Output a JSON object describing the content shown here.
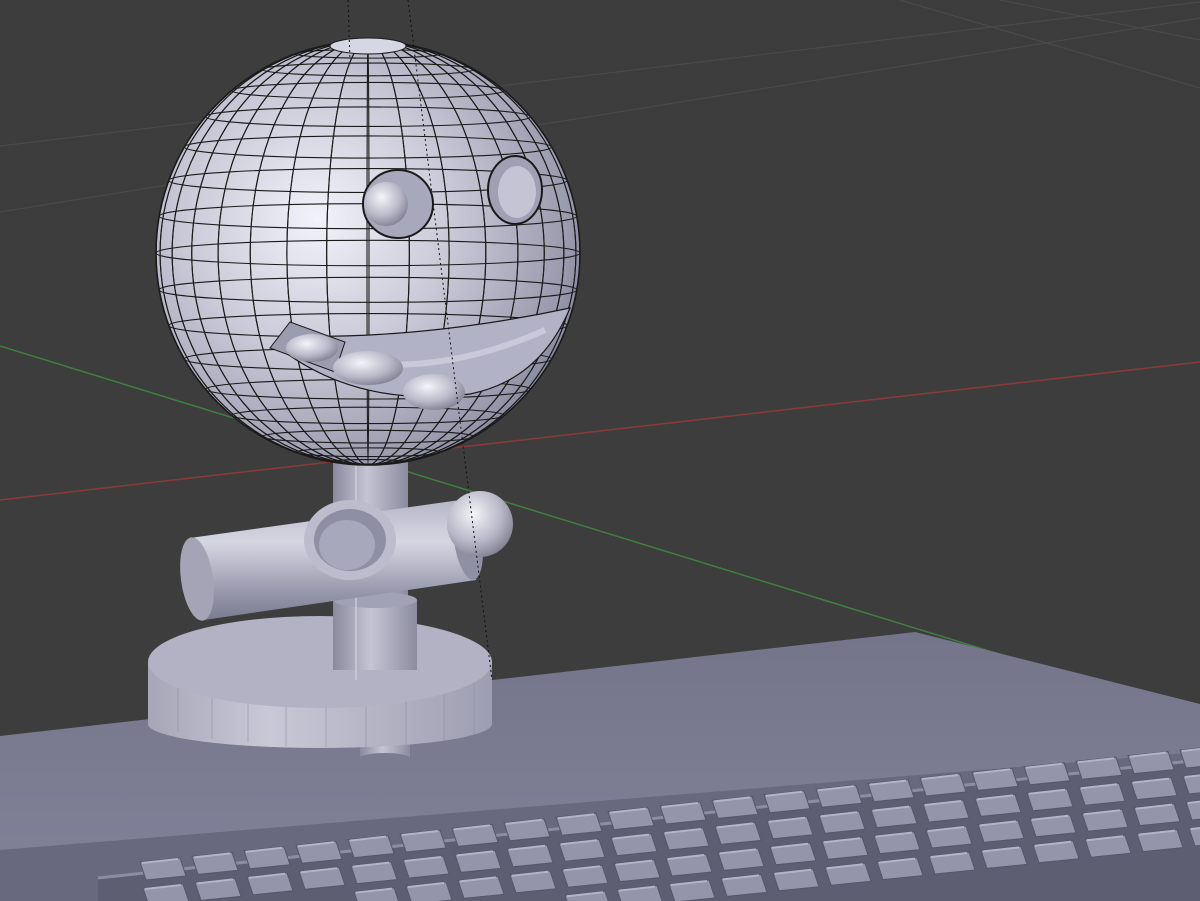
{
  "viewport": {
    "kind": "blender-3d-viewport",
    "view": "perspective",
    "shading": "solid",
    "wireframe_overlay_on_selected": true,
    "colors": {
      "background": "#3d3d3d",
      "grid": "#4a4a4a",
      "x_axis": "#8b3a3a",
      "y_axis": "#3f7f3f",
      "mesh_light": "#e6e6f0",
      "mesh_mid": "#b4b4c6",
      "mesh_dark": "#76768a",
      "edges": "#1a1a1a"
    }
  },
  "scene": {
    "objects": [
      "sphere-head",
      "eye-hole-left",
      "eye-hole-right",
      "mouth-opening",
      "teeth",
      "neck-cylinder",
      "horizontal-tube",
      "tube-ring",
      "small-sphere",
      "base-disc",
      "lower-pin",
      "ground-slab",
      "studded-panel"
    ]
  }
}
